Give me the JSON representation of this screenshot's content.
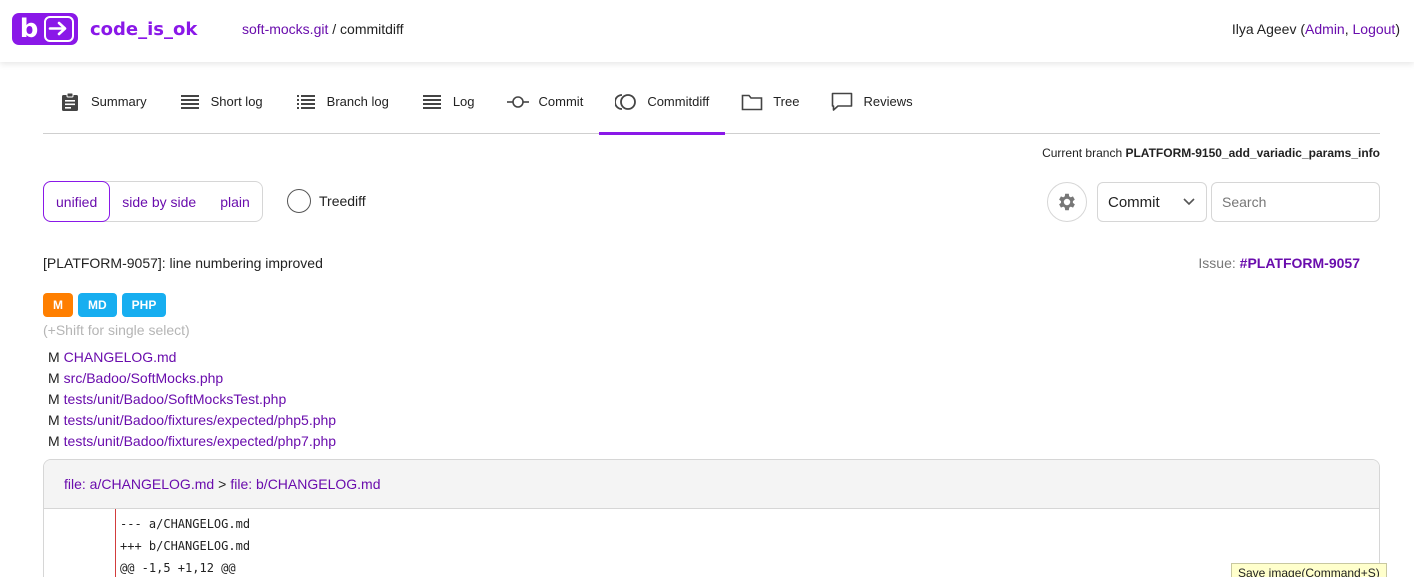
{
  "brand": {
    "name": "code_is_ok",
    "logo_letter": "b",
    "color": "#8a18e8"
  },
  "breadcrumb": {
    "repo": "soft-mocks.git",
    "separator": "/",
    "page": "commitdiff"
  },
  "user": {
    "name": "Ilya Ageev",
    "open": "(",
    "admin": "Admin",
    "comma": ",",
    "logout": "Logout",
    "close": ")"
  },
  "tabs": [
    {
      "label": "Summary",
      "icon": "clipboard-icon"
    },
    {
      "label": "Short log",
      "icon": "list-icon"
    },
    {
      "label": "Branch log",
      "icon": "bullet-list-icon"
    },
    {
      "label": "Log",
      "icon": "lines-icon"
    },
    {
      "label": "Commit",
      "icon": "commit-icon"
    },
    {
      "label": "Commitdiff",
      "icon": "commitdiff-icon",
      "active": true
    },
    {
      "label": "Tree",
      "icon": "folder-icon"
    },
    {
      "label": "Reviews",
      "icon": "comment-icon"
    }
  ],
  "branch": {
    "prefix": "Current branch",
    "name": "PLATFORM-9150_add_variadic_params_info"
  },
  "diff_modes": {
    "unified": "unified",
    "side_by_side": "side by side",
    "plain": "plain",
    "treediff": "Treediff"
  },
  "toolbar": {
    "select_value": "Commit",
    "search_placeholder": "Search"
  },
  "commit": {
    "message": "[PLATFORM-9057]: line numbering improved",
    "issue_label": "Issue:",
    "issue_id": "#PLATFORM-9057"
  },
  "filetypes": [
    {
      "label": "M",
      "color": "#ff7f00"
    },
    {
      "label": "MD",
      "color": "#17aef0"
    },
    {
      "label": "PHP",
      "color": "#17aef0"
    }
  ],
  "shift_hint": "(+Shift for single select)",
  "files": [
    {
      "status": "M",
      "path": "CHANGELOG.md"
    },
    {
      "status": "M",
      "path": "src/Badoo/SoftMocks.php"
    },
    {
      "status": "M",
      "path": "tests/unit/Badoo/SoftMocksTest.php"
    },
    {
      "status": "M",
      "path": "tests/unit/Badoo/fixtures/expected/php5.php"
    },
    {
      "status": "M",
      "path": "tests/unit/Badoo/fixtures/expected/php7.php"
    }
  ],
  "diff": {
    "file_a_label": "file: a/CHANGELOG.md",
    "arrow": ">",
    "file_b_label": "file: b/CHANGELOG.md",
    "lines": [
      "--- a/CHANGELOG.md",
      "+++ b/CHANGELOG.md",
      "@@ -1,5 +1,12 @@"
    ]
  },
  "tooltip": "Save image(Command+S)"
}
